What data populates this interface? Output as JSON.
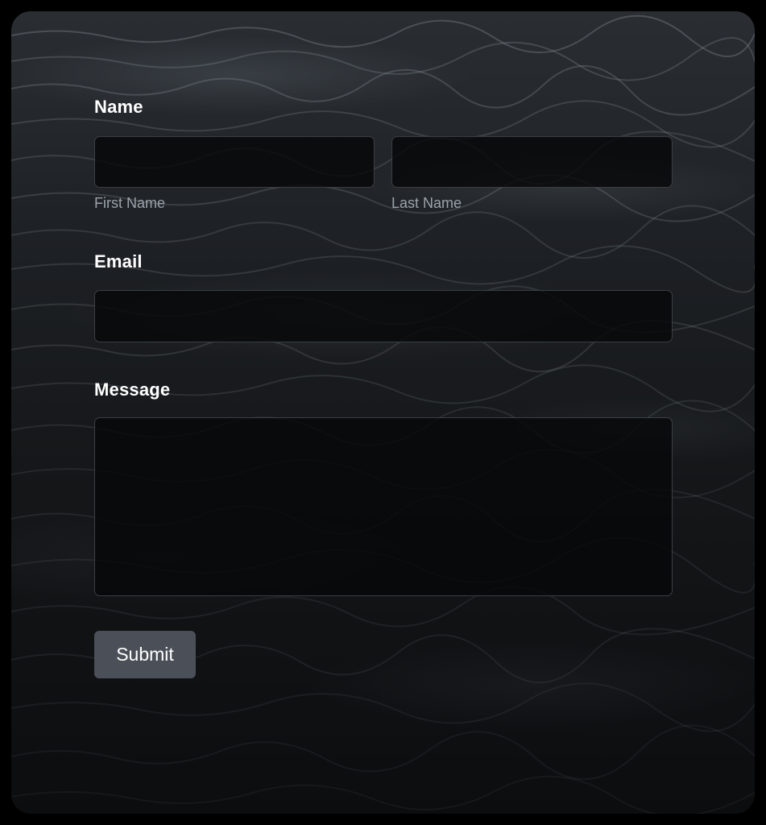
{
  "form": {
    "name_label": "Name",
    "first_name_value": "",
    "first_name_sublabel": "First Name",
    "last_name_value": "",
    "last_name_sublabel": "Last Name",
    "email_label": "Email",
    "email_value": "",
    "message_label": "Message",
    "message_value": "",
    "submit_label": "Submit"
  },
  "colors": {
    "background": "#000000",
    "input_fill": "#060708",
    "input_border": "#3a3e43",
    "label_text": "#ffffff",
    "sublabel_text": "#9ca3ab",
    "button_fill": "#4b5058"
  }
}
